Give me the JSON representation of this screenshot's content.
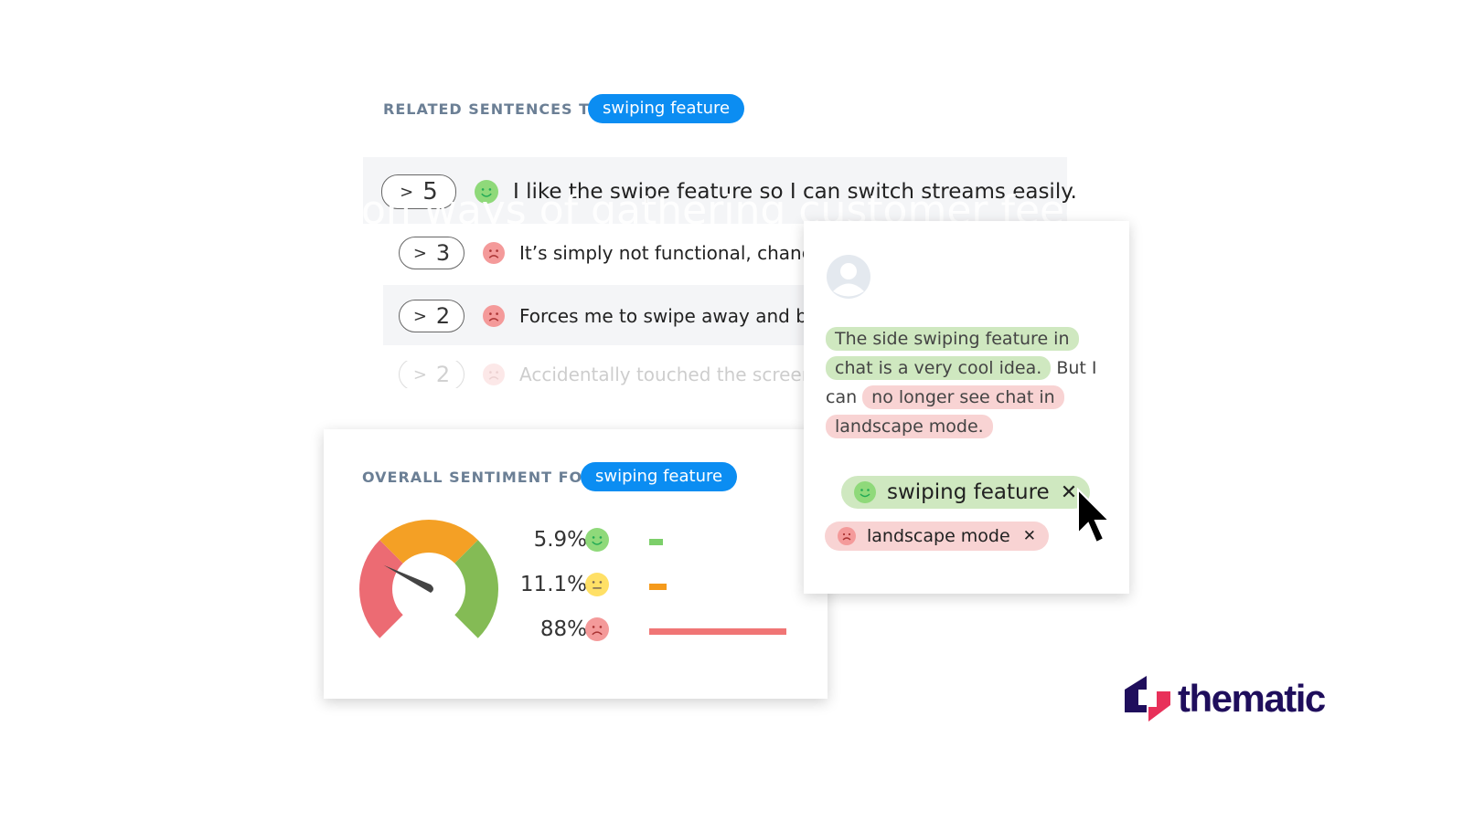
{
  "related": {
    "label": "RELATED SENTENCES TO",
    "theme": "swiping feature"
  },
  "overlay_text": "on ways of gathering customer feedb",
  "sentences": [
    {
      "count": "5",
      "sentiment": "positive",
      "text": "I like the swipe feature so I can switch streams easily."
    },
    {
      "count": "3",
      "sentiment": "negative",
      "text": "It’s simply not functional, changing"
    },
    {
      "count": "2",
      "sentiment": "negative",
      "text": "Forces me to swipe away and back"
    },
    {
      "count": "2",
      "sentiment": "negative",
      "text": "Accidentally  touched the screen an"
    }
  ],
  "overall": {
    "label": "OVERALL SENTIMENT FOR",
    "theme": "swiping feature",
    "rows": [
      {
        "pct": "5.9%",
        "sentiment": "positive",
        "value": 5.9,
        "color": "#7ccf6a"
      },
      {
        "pct": "11.1%",
        "sentiment": "neutral",
        "value": 11.1,
        "color": "#f59a1b"
      },
      {
        "pct": "88%",
        "sentiment": "negative",
        "value": 88,
        "color": "#f07575"
      }
    ],
    "gauge_colors": {
      "negative": "#ec6b73",
      "neutral": "#f4a025",
      "positive": "#84bb55"
    }
  },
  "comment": {
    "parts": [
      {
        "t": "The side swiping feature in chat is a very cool idea.",
        "hl": "pos"
      },
      {
        "t": " But I can ",
        "hl": ""
      },
      {
        "t": "no longer see chat in landscape mode.",
        "hl": "neg"
      }
    ],
    "tags": [
      {
        "label": "swiping feature",
        "sentiment": "positive"
      },
      {
        "label": "landscape mode",
        "sentiment": "negative"
      }
    ]
  },
  "logo": {
    "text": "thematic"
  },
  "colors": {
    "accent": "#0b8df2",
    "positive": "#8fd97a",
    "negative": "#f49a9a",
    "neutral": "#ffe066",
    "brand": "#1f0e5c",
    "brand_red": "#e8315a"
  }
}
